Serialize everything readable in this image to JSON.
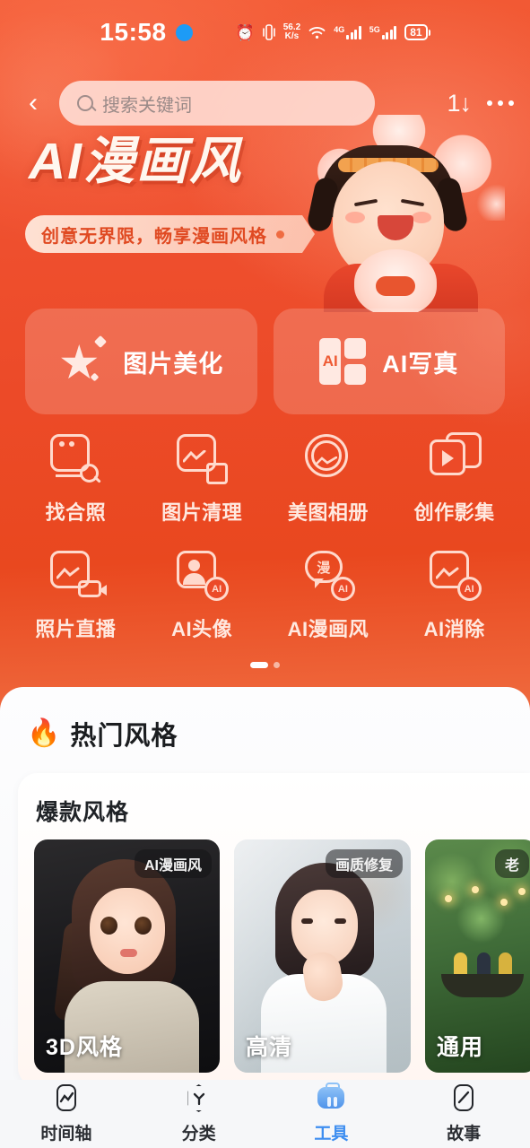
{
  "status_bar": {
    "time": "15:58",
    "net_rate_top": "56.2",
    "net_rate_bottom": "K/s",
    "battery": "81",
    "icons": [
      "blue-dot",
      "alarm-icon",
      "vibrate-icon",
      "network-rate",
      "wifi-icon",
      "signal-4g-icon",
      "signal-5g-icon",
      "battery-icon"
    ],
    "sig1_label": "4G",
    "sig2_label": "5G",
    "alarm_glyph": "⏰",
    "vibrate_glyph": "▯"
  },
  "header": {
    "back_icon": "‹",
    "search_placeholder": "搜索关键词",
    "download_icon": "1↓",
    "more_icon": "more-dots"
  },
  "hero": {
    "title": "AI漫画风",
    "subtitle": "创意无界限，畅享漫画风格"
  },
  "big_cards": [
    {
      "label": "图片美化",
      "icon": "magic-wand-icon"
    },
    {
      "label": "AI写真",
      "icon": "ai-grid-icon",
      "icon_text": "AI"
    }
  ],
  "tools": [
    {
      "label": "找合照",
      "icon": "find-group-photo-icon"
    },
    {
      "label": "图片清理",
      "icon": "photo-cleanup-icon"
    },
    {
      "label": "美图相册",
      "icon": "beauty-album-icon"
    },
    {
      "label": "创作影集",
      "icon": "create-album-icon"
    },
    {
      "label": "照片直播",
      "icon": "photo-live-icon"
    },
    {
      "label": "AI头像",
      "icon": "ai-avatar-icon",
      "badge": "AI"
    },
    {
      "label": "AI漫画风",
      "icon": "ai-comic-style-icon",
      "bubble_text": "漫",
      "badge": "AI"
    },
    {
      "label": "AI消除",
      "icon": "ai-erase-icon",
      "badge": "AI"
    }
  ],
  "pager": {
    "active": 1,
    "count": 2
  },
  "hot_section": {
    "fire_icon": "🔥",
    "title": "热门风格",
    "card_title": "爆款风格",
    "styles": [
      {
        "badge": "AI漫画风",
        "caption": "3D风格"
      },
      {
        "badge": "画质修复",
        "caption": "高清"
      },
      {
        "badge": "老",
        "caption": "通用"
      }
    ]
  },
  "bottom_nav": [
    {
      "label": "时间轴",
      "icon": "timeline-icon",
      "active": false
    },
    {
      "label": "分类",
      "icon": "category-icon",
      "active": false
    },
    {
      "label": "工具",
      "icon": "toolbox-icon",
      "active": true
    },
    {
      "label": "故事",
      "icon": "story-icon",
      "active": false
    }
  ],
  "colors": {
    "brand_red": "#ec4a28",
    "accent_blue": "#3e8ef0",
    "sheet_bg": "#f6f7f9"
  }
}
